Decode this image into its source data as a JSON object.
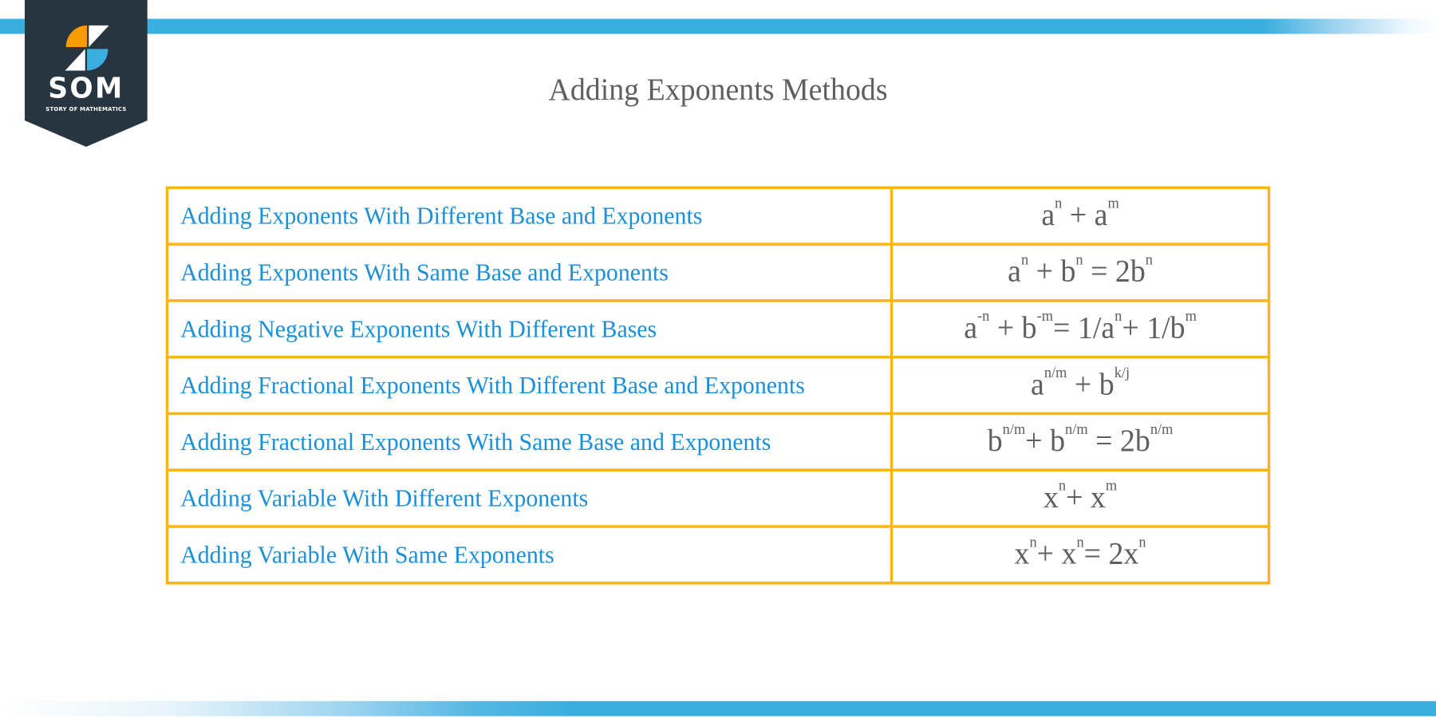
{
  "brand": {
    "logo_initials": "SOM",
    "logo_tagline": "STORY OF MATHEMATICS",
    "colors": {
      "logo_bg": "#263540",
      "logo_orange": "#f59c00",
      "logo_blue": "#3aaedf",
      "band_blue": "#3aaedf",
      "table_border": "#fbb615",
      "method_text": "#1a90d8",
      "formula_text": "#5f5f5f"
    }
  },
  "title": "Adding Exponents Methods",
  "table": {
    "rows": [
      {
        "method": "Adding Exponents With Different Base and Exponents",
        "formula": [
          {
            "t": "a"
          },
          {
            "sup": "n"
          },
          {
            "t": " + a"
          },
          {
            "sup": "m"
          }
        ]
      },
      {
        "method": "Adding Exponents With Same Base and Exponents",
        "formula": [
          {
            "t": "a"
          },
          {
            "sup": "n"
          },
          {
            "t": " + b"
          },
          {
            "sup": "n"
          },
          {
            "t": " = 2b"
          },
          {
            "sup": "n"
          }
        ]
      },
      {
        "method": "Adding Negative Exponents With Different Bases",
        "formula": [
          {
            "t": "a"
          },
          {
            "sup": "-n"
          },
          {
            "t": " + b"
          },
          {
            "sup": "-m"
          },
          {
            "t": "= 1/a"
          },
          {
            "sup": "n"
          },
          {
            "t": "+ 1/b"
          },
          {
            "sup": "m"
          }
        ]
      },
      {
        "method": "Adding Fractional Exponents With Different Base and Exponents",
        "formula": [
          {
            "t": "a"
          },
          {
            "sup": "n/m"
          },
          {
            "t": " + b"
          },
          {
            "sup": "k/j"
          }
        ]
      },
      {
        "method": "Adding Fractional Exponents With Same Base and Exponents",
        "formula": [
          {
            "t": "b"
          },
          {
            "sup": "n/m"
          },
          {
            "t": "+ b"
          },
          {
            "sup": "n/m"
          },
          {
            "t": " = 2b"
          },
          {
            "sup": "n/m"
          }
        ]
      },
      {
        "method": "Adding Variable With Different Exponents",
        "formula": [
          {
            "t": "x"
          },
          {
            "sup": "n"
          },
          {
            "t": "+ x"
          },
          {
            "sup": "m"
          }
        ]
      },
      {
        "method": "Adding Variable With Same Exponents",
        "formula": [
          {
            "t": "x"
          },
          {
            "sup": "n"
          },
          {
            "t": "+ x"
          },
          {
            "sup": "n"
          },
          {
            "t": "= 2x"
          },
          {
            "sup": "n"
          }
        ]
      }
    ]
  }
}
